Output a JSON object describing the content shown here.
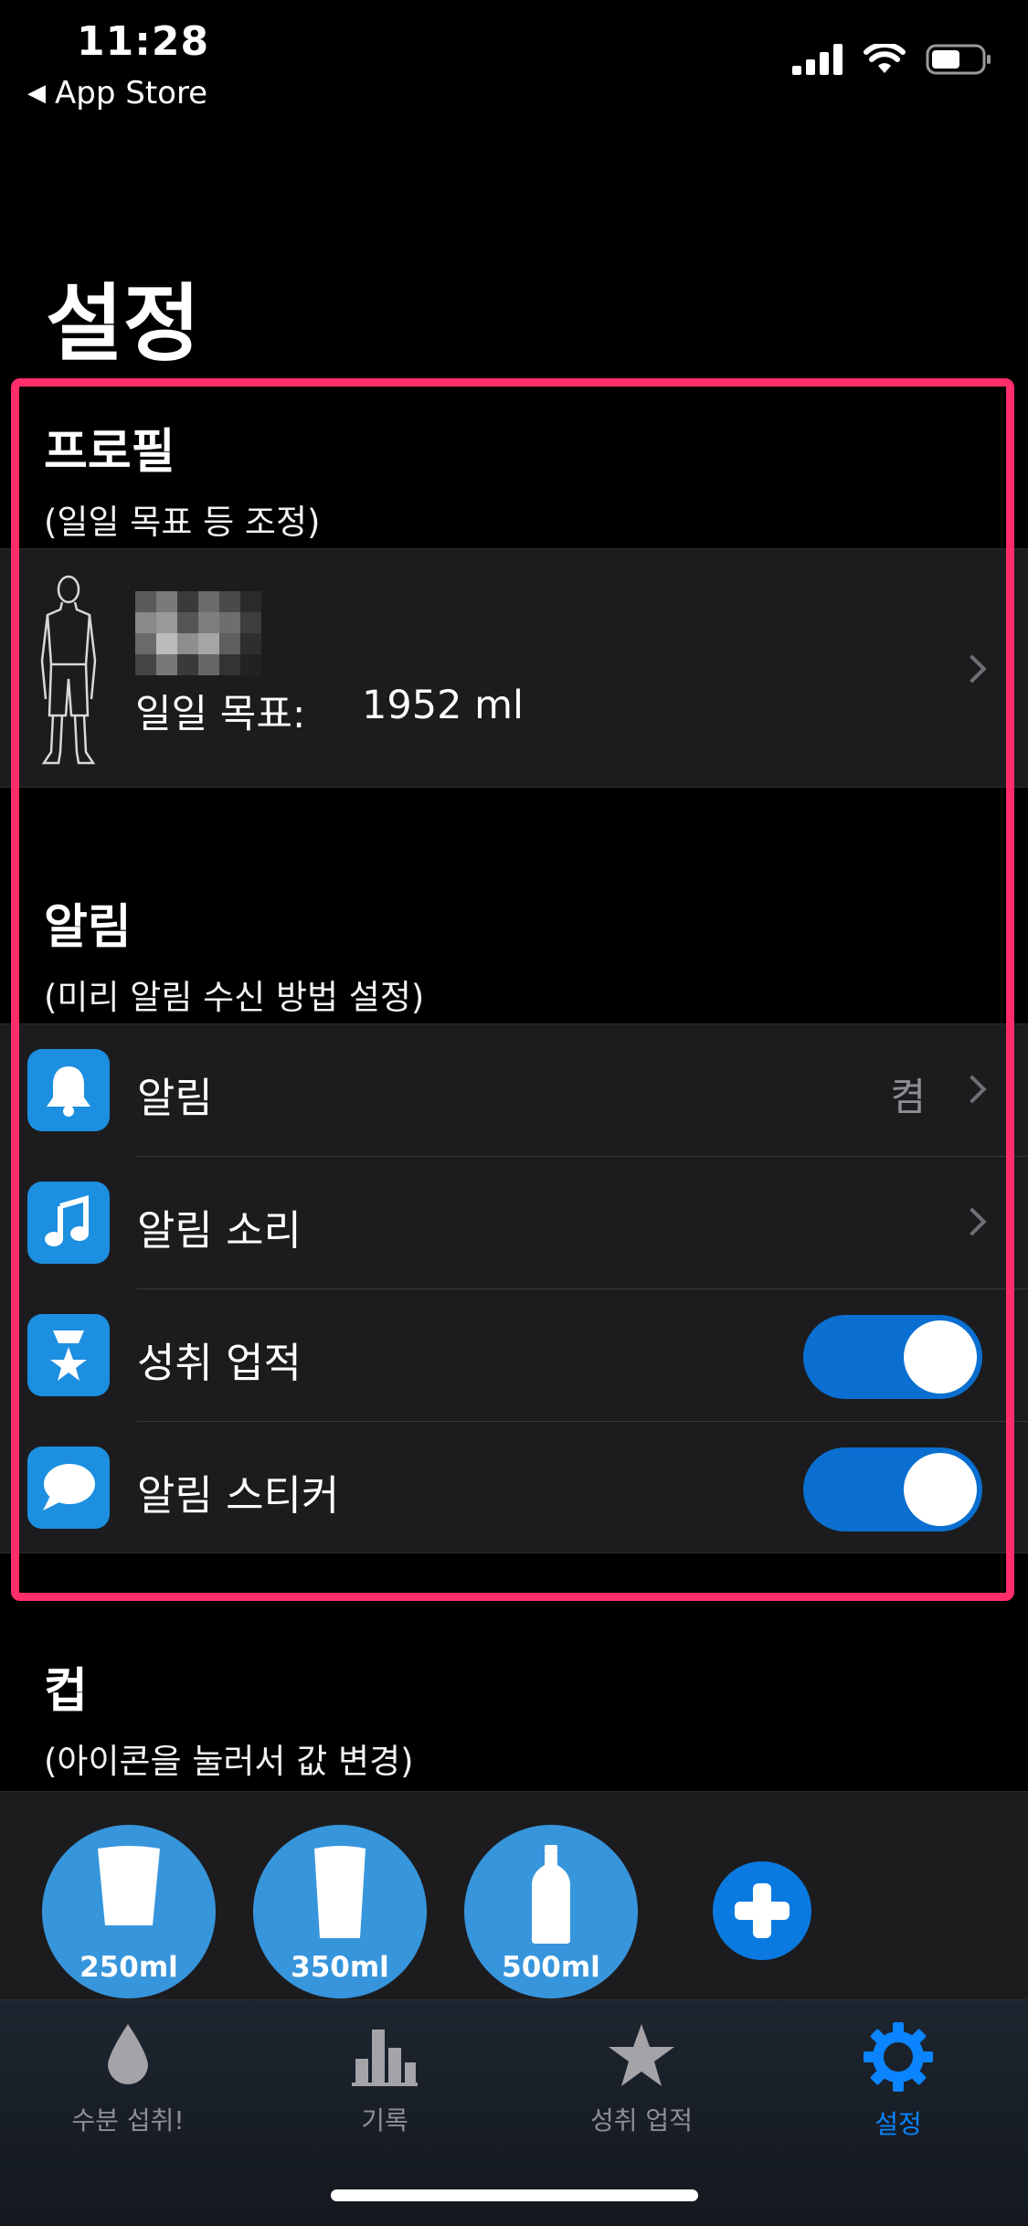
{
  "status_bar": {
    "time": "11:28",
    "back_app": "App Store"
  },
  "page": {
    "title": "설정"
  },
  "profile": {
    "title": "프로필",
    "subtitle": "(일일 목표 등 조정)",
    "goal_label": "일일 목표:",
    "goal_value": "1952 ml"
  },
  "alarm": {
    "title": "알림",
    "subtitle": "(미리 알림 수신 방법 설정)",
    "rows": [
      {
        "label": "알림",
        "value": "켬",
        "icon": "bell-icon"
      },
      {
        "label": "알림 소리",
        "icon": "music-note-icon"
      },
      {
        "label": "성취 업적",
        "icon": "trophy-icon",
        "toggle_on": true
      },
      {
        "label": "알림 스티커",
        "icon": "speech-bubble-icon",
        "toggle_on": true
      }
    ]
  },
  "cup": {
    "title": "컵",
    "subtitle": "(아이콘을 눌러서 값 변경)",
    "items": [
      {
        "label": "250ml",
        "icon": "glass-icon"
      },
      {
        "label": "350ml",
        "icon": "tall-glass-icon"
      },
      {
        "label": "500ml",
        "icon": "bottle-icon"
      }
    ]
  },
  "tabs": [
    {
      "label": "수분 섭취!",
      "icon": "water-drop-icon"
    },
    {
      "label": "기록",
      "icon": "bar-chart-icon"
    },
    {
      "label": "성취 업적",
      "icon": "star-icon"
    },
    {
      "label": "설정",
      "icon": "gear-icon",
      "active": true
    }
  ],
  "colors": {
    "accent": "#0a84ff",
    "icon_blue": "#1c8fe0",
    "highlight_border": "#ff2d6a",
    "cup_blue": "#3795dc",
    "background": "#000000",
    "row_background": "#1c1c1e"
  }
}
